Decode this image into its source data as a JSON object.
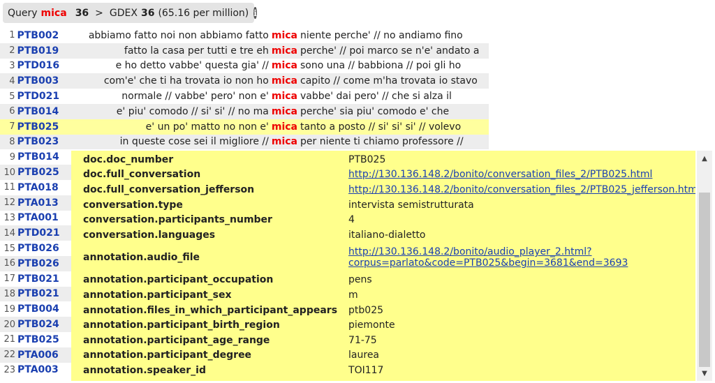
{
  "query": {
    "label": "Query",
    "term": "mica",
    "count": "36",
    "separator": ">",
    "corpus": "GDEX",
    "corpus_count": "36",
    "relative": "(65.16 per million)",
    "info_icon": "info-icon"
  },
  "rows": [
    {
      "n": "1",
      "doc": "PTB002",
      "left": "abbiamo fatto noi non abbiamo fatto",
      "kw": "mica",
      "right": "niente perche' // no andiamo fino"
    },
    {
      "n": "2",
      "doc": "PTB019",
      "left": "fatto la casa per tutti e tre eh",
      "kw": "mica",
      "right": "perche' // poi marco se n'e' andato a"
    },
    {
      "n": "3",
      "doc": "PTD016",
      "left": "e ho detto vabbe' questa gia' //",
      "kw": "mica",
      "right": "sono una // babbiona // poi gli ho"
    },
    {
      "n": "4",
      "doc": "PTB003",
      "left": "com'e' che ti ha trovata io non ho",
      "kw": "mica",
      "right": "capito // come m'ha trovata io stavo"
    },
    {
      "n": "5",
      "doc": "PTD021",
      "left": "normale // vabbe' pero' non e'",
      "kw": "mica",
      "right": "vabbe' dai pero' // che si alza il"
    },
    {
      "n": "6",
      "doc": "PTB014",
      "left": "e' piu' comodo // si' si' // no ma",
      "kw": "mica",
      "right": "perche' sia piu' comodo e' che"
    },
    {
      "n": "7",
      "doc": "PTB025",
      "left": "e' un po' matto no non e'",
      "kw": "mica",
      "right": "tanto a posto // si' si' si' // volevo"
    },
    {
      "n": "8",
      "doc": "PTB023",
      "left": "in queste cose sei il migliore //",
      "kw": "mica",
      "right": "per niente ti chiamo professore //"
    },
    {
      "n": "9",
      "doc": "PTB014"
    },
    {
      "n": "10",
      "doc": "PTB025"
    },
    {
      "n": "11",
      "doc": "PTA018"
    },
    {
      "n": "12",
      "doc": "PTA013"
    },
    {
      "n": "13",
      "doc": "PTA001"
    },
    {
      "n": "14",
      "doc": "PTD021"
    },
    {
      "n": "15",
      "doc": "PTB026"
    },
    {
      "n": "16",
      "doc": "PTB026"
    },
    {
      "n": "17",
      "doc": "PTB021"
    },
    {
      "n": "18",
      "doc": "PTB021"
    },
    {
      "n": "19",
      "doc": "PTB004"
    },
    {
      "n": "20",
      "doc": "PTB024"
    },
    {
      "n": "21",
      "doc": "PTB025"
    },
    {
      "n": "22",
      "doc": "PTA006"
    },
    {
      "n": "23",
      "doc": "PTA003"
    }
  ],
  "popup": {
    "fields": [
      {
        "key": "doc.doc_number",
        "value": "PTB025"
      },
      {
        "key": "doc.full_conversation",
        "value": "http://130.136.148.2/bonito/conversation_files_2/PTB025.html",
        "link": true
      },
      {
        "key": "doc.full_conversation_jefferson",
        "value": "http://130.136.148.2/bonito/conversation_files_2/PTB025_jefferson.html",
        "link": true
      },
      {
        "key": "conversation.type",
        "value": "intervista semistrutturata"
      },
      {
        "key": "conversation.participants_number",
        "value": "4"
      },
      {
        "key": "conversation.languages",
        "value": "italiano-dialetto"
      },
      {
        "key": "annotation.audio_file",
        "value_line1": "http://130.136.148.2/bonito/audio_player_2.html?",
        "value_line2": "corpus=parlato&code=PTB025&begin=3681&end=3693",
        "link": true
      },
      {
        "key": "annotation.participant_occupation",
        "value": "pens"
      },
      {
        "key": "annotation.participant_sex",
        "value": "m"
      },
      {
        "key": "annotation.files_in_which_participant_appears",
        "value": "ptb025"
      },
      {
        "key": "annotation.participant_birth_region",
        "value": "piemonte"
      },
      {
        "key": "annotation.participant_age_range",
        "value": "71-75"
      },
      {
        "key": "annotation.participant_degree",
        "value": "laurea"
      },
      {
        "key": "annotation.speaker_id",
        "value": "TOI117"
      }
    ]
  },
  "scrollbar": {
    "up_icon": "▲",
    "down_icon": "▼"
  },
  "colors": {
    "keyword": "#e00000",
    "doc_link": "#1a3fb0",
    "popup_bg": "#ffff8c",
    "highlight_row": "#ffff9e",
    "alt_row": "#ededed"
  }
}
